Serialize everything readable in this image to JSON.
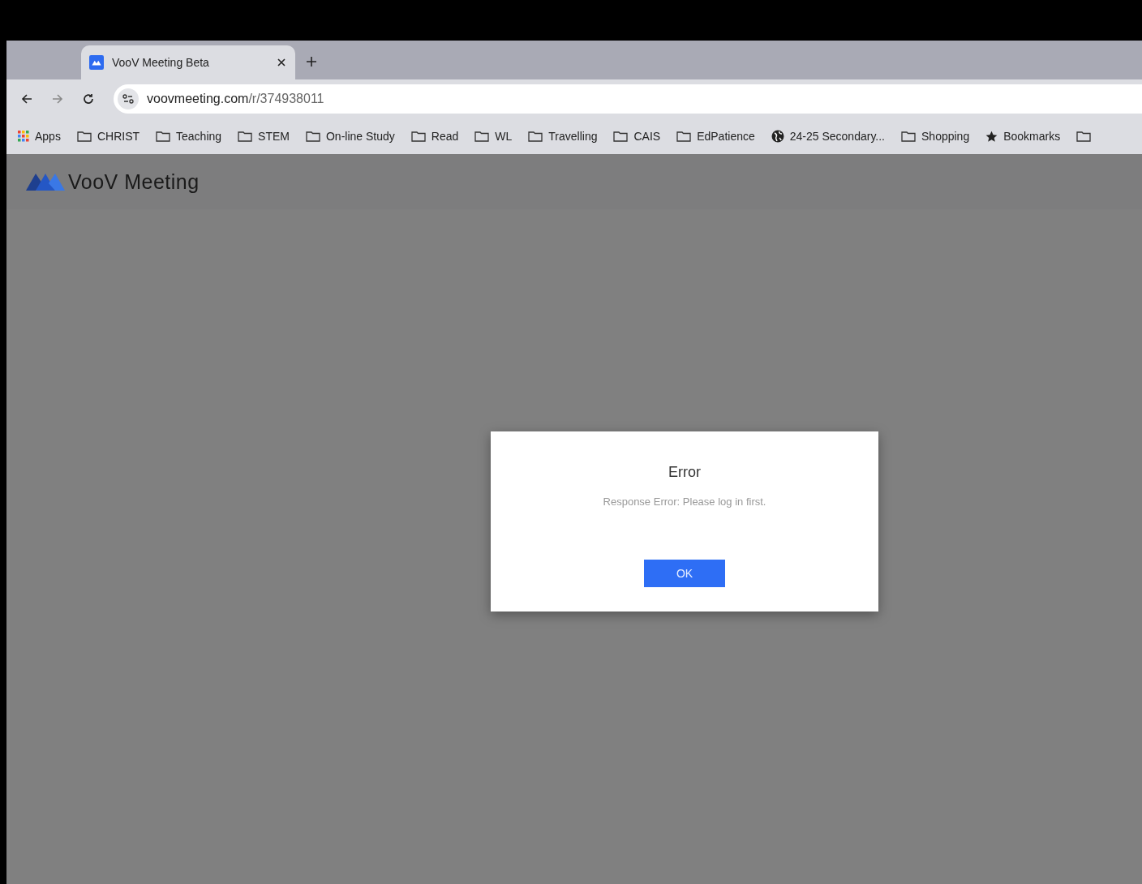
{
  "tab": {
    "title": "VooV Meeting Beta",
    "selected": true
  },
  "address": {
    "host": "voovmeeting.com",
    "path": "/r/374938011"
  },
  "bookmarks": [
    {
      "kind": "apps",
      "label": "Apps"
    },
    {
      "kind": "folder",
      "label": "CHRIST"
    },
    {
      "kind": "folder",
      "label": "Teaching"
    },
    {
      "kind": "folder",
      "label": "STEM"
    },
    {
      "kind": "folder",
      "label": "On-line Study"
    },
    {
      "kind": "folder",
      "label": "Read"
    },
    {
      "kind": "folder",
      "label": "WL"
    },
    {
      "kind": "folder",
      "label": "Travelling"
    },
    {
      "kind": "folder",
      "label": "CAIS"
    },
    {
      "kind": "folder",
      "label": "EdPatience"
    },
    {
      "kind": "site",
      "label": "24-25 Secondary..."
    },
    {
      "kind": "folder",
      "label": "Shopping"
    },
    {
      "kind": "star",
      "label": "Bookmarks"
    },
    {
      "kind": "folder"
    }
  ],
  "app": {
    "name": "VooV Meeting"
  },
  "dialog": {
    "title": "Error",
    "message": "Response Error: Please log in first.",
    "button": "OK"
  }
}
